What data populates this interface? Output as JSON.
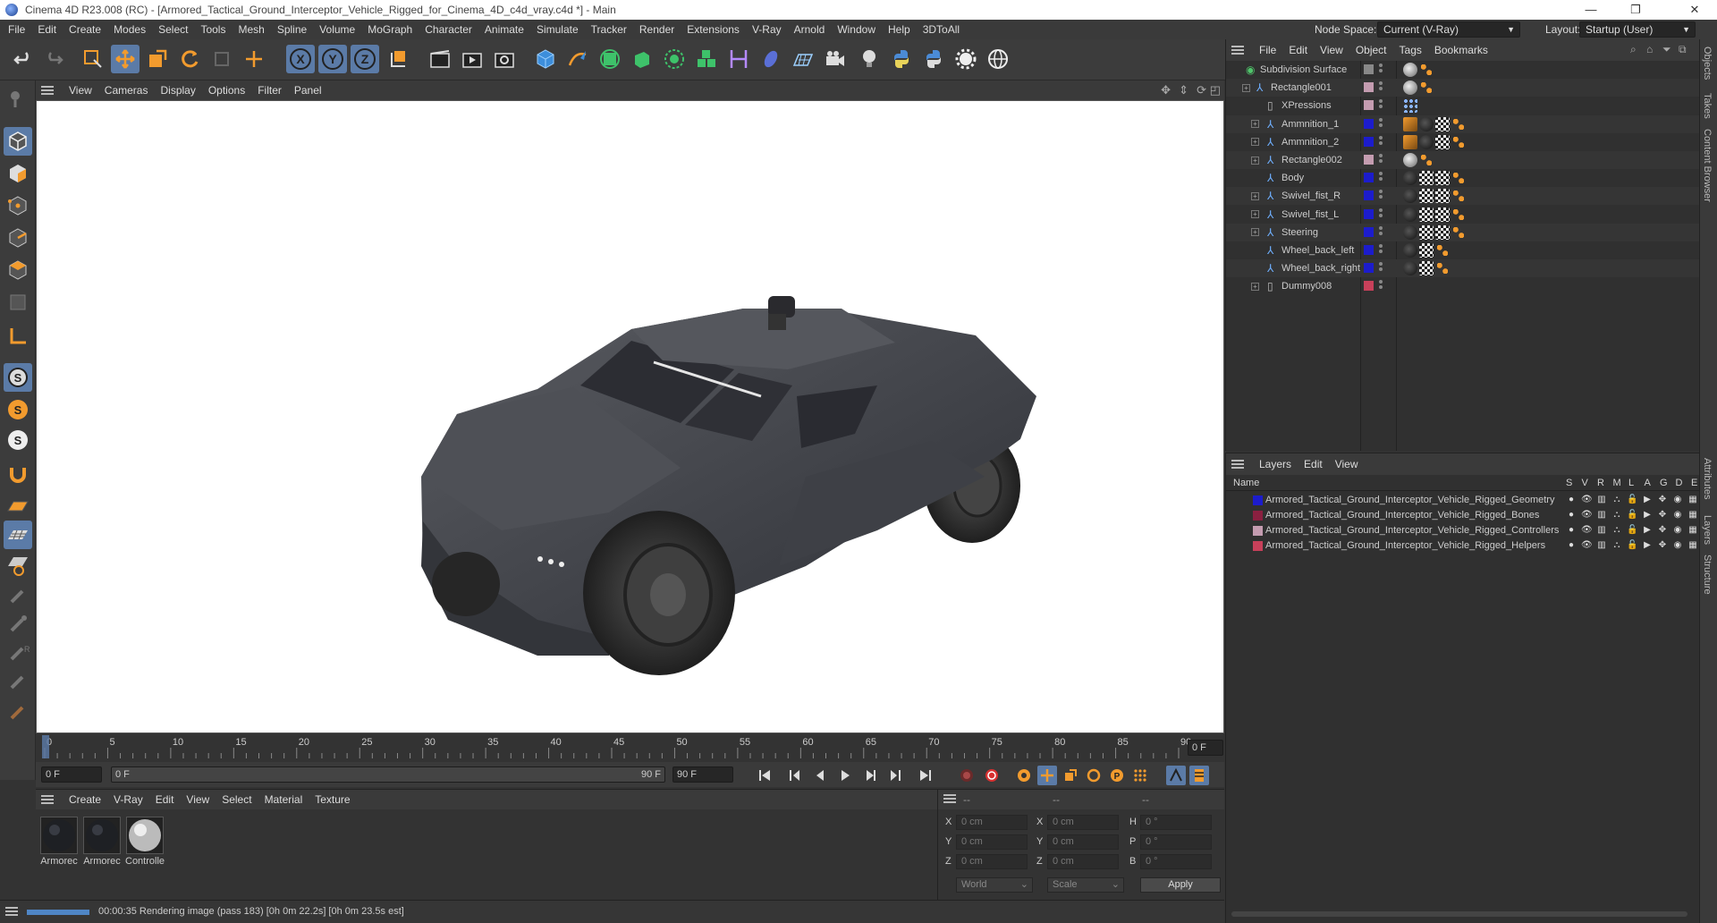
{
  "window": {
    "title": "Cinema 4D R23.008 (RC) - [Armored_Tactical_Ground_Interceptor_Vehicle_Rigged_for_Cinema_4D_c4d_vray.c4d *] - Main",
    "minimize": "—",
    "maximize": "❐",
    "close": "✕"
  },
  "menubar": {
    "items": [
      "File",
      "Edit",
      "Create",
      "Modes",
      "Select",
      "Tools",
      "Mesh",
      "Spline",
      "Volume",
      "MoGraph",
      "Character",
      "Animate",
      "Simulate",
      "Tracker",
      "Render",
      "Extensions",
      "V-Ray",
      "Arnold",
      "Window",
      "Help",
      "3DToAll"
    ],
    "node_space_label": "Node Space:",
    "node_space_value": "Current (V-Ray)",
    "layout_label": "Layout:",
    "layout_value": "Startup (User)"
  },
  "viewport": {
    "menu": [
      "View",
      "Cameras",
      "Display",
      "Options",
      "Filter",
      "Panel"
    ]
  },
  "timeline": {
    "ticks": [
      "0",
      "5",
      "10",
      "15",
      "20",
      "25",
      "30",
      "35",
      "40",
      "45",
      "50",
      "55",
      "60",
      "65",
      "70",
      "75",
      "80",
      "85",
      "90"
    ],
    "current_frame": "0 F",
    "start_field": "0 F",
    "range_start": "0 F",
    "range_end": "90 F",
    "end_field": "90 F"
  },
  "material_panel": {
    "menu": [
      "Create",
      "V-Ray",
      "Edit",
      "View",
      "Select",
      "Material",
      "Texture"
    ],
    "materials": [
      {
        "name": "Armorec"
      },
      {
        "name": "Armorec"
      },
      {
        "name": "Controlle"
      }
    ]
  },
  "coord_panel": {
    "header": [
      "--",
      "--",
      "--"
    ],
    "rows": [
      {
        "a_label": "X",
        "a_val": "0 cm",
        "b_label": "X",
        "b_val": "0 cm",
        "c_label": "H",
        "c_val": "0 °"
      },
      {
        "a_label": "Y",
        "a_val": "0 cm",
        "b_label": "Y",
        "b_val": "0 cm",
        "c_label": "P",
        "c_val": "0 °"
      },
      {
        "a_label": "Z",
        "a_val": "0 cm",
        "b_label": "Z",
        "b_val": "0 cm",
        "c_label": "B",
        "c_val": "0 °"
      }
    ],
    "space_select": "World",
    "mode_select": "Scale",
    "apply_label": "Apply"
  },
  "statusbar": {
    "text": "00:00:35 Rendering image (pass 183) [0h  0m 22.2s] [0h  0m 23.5s est]",
    "progress": 1.0
  },
  "object_manager": {
    "menu": [
      "File",
      "Edit",
      "View",
      "Object",
      "Tags",
      "Bookmarks"
    ],
    "objects": [
      {
        "name": "Subdivision Surface",
        "color": "#888888"
      },
      {
        "name": "Rectangle001",
        "color": "#c49cb0"
      },
      {
        "name": "XPressions",
        "color": "#c49cb0"
      },
      {
        "name": "Ammnition_1",
        "color": "#1c1ccc"
      },
      {
        "name": "Ammnition_2",
        "color": "#1c1ccc"
      },
      {
        "name": "Rectangle002",
        "color": "#c49cb0"
      },
      {
        "name": "Body",
        "color": "#1c1ccc"
      },
      {
        "name": "Swivel_fist_R",
        "color": "#1c1ccc"
      },
      {
        "name": "Swivel_fist_L",
        "color": "#1c1ccc"
      },
      {
        "name": "Steering",
        "color": "#1c1ccc"
      },
      {
        "name": "Wheel_back_left",
        "color": "#1c1ccc"
      },
      {
        "name": "Wheel_back_right",
        "color": "#1c1ccc"
      },
      {
        "name": "Dummy008",
        "color": "#c8405a"
      }
    ]
  },
  "layer_manager": {
    "menu": [
      "Layers",
      "Edit",
      "View"
    ],
    "col_name": "Name",
    "col_flags": [
      "S",
      "V",
      "R",
      "M",
      "L",
      "A",
      "G",
      "D",
      "E"
    ],
    "layers": [
      {
        "name": "Armored_Tactical_Ground_Interceptor_Vehicle_Rigged_Geometry",
        "color": "#1c1ccc"
      },
      {
        "name": "Armored_Tactical_Ground_Interceptor_Vehicle_Rigged_Bones",
        "color": "#8a2040"
      },
      {
        "name": "Armored_Tactical_Ground_Interceptor_Vehicle_Rigged_Controllers",
        "color": "#c49cb0"
      },
      {
        "name": "Armored_Tactical_Ground_Interceptor_Vehicle_Rigged_Helpers",
        "color": "#c8405a"
      }
    ]
  },
  "right_tabs": [
    "Objects",
    "Takes",
    "Content Browser",
    "Attributes",
    "Layers",
    "Structure"
  ]
}
